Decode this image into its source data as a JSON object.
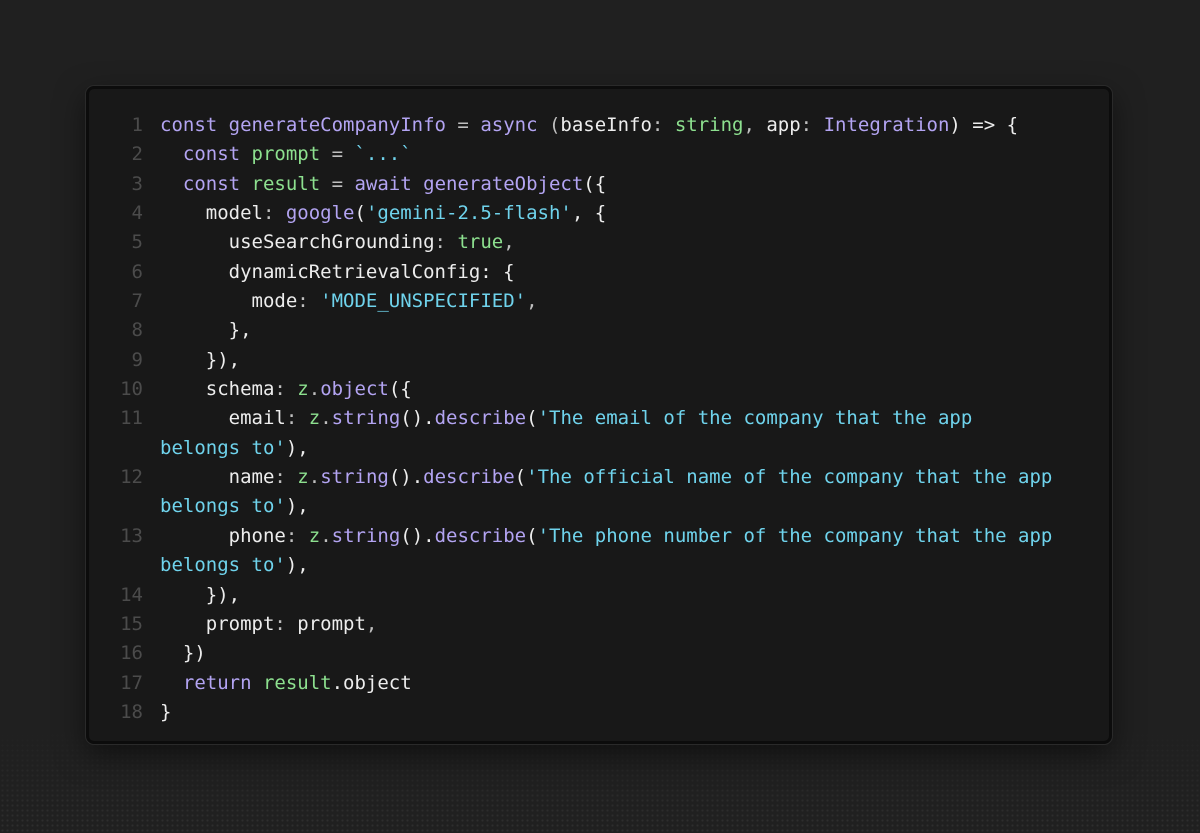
{
  "editor": {
    "lines": [
      {
        "number": "1",
        "tokens": [
          {
            "t": "const ",
            "c": "kw"
          },
          {
            "t": "generateCompanyInfo",
            "c": "fn"
          },
          {
            "t": " = ",
            "c": "p"
          },
          {
            "t": "async",
            "c": "kw"
          },
          {
            "t": " (",
            "c": "p"
          },
          {
            "t": "baseInfo",
            "c": "t"
          },
          {
            "t": ": ",
            "c": "p"
          },
          {
            "t": "string",
            "c": "def"
          },
          {
            "t": ", ",
            "c": "p"
          },
          {
            "t": "app",
            "c": "t"
          },
          {
            "t": ": ",
            "c": "p"
          },
          {
            "t": "Integration",
            "c": "type"
          },
          {
            "t": ") => {",
            "c": "t"
          }
        ]
      },
      {
        "number": "2",
        "tokens": [
          {
            "t": "  const ",
            "c": "kw"
          },
          {
            "t": "prompt",
            "c": "def"
          },
          {
            "t": " = ",
            "c": "p"
          },
          {
            "t": "`...`",
            "c": "str"
          }
        ]
      },
      {
        "number": "3",
        "tokens": [
          {
            "t": "  const ",
            "c": "kw"
          },
          {
            "t": "result",
            "c": "def"
          },
          {
            "t": " = ",
            "c": "p"
          },
          {
            "t": "await ",
            "c": "kw"
          },
          {
            "t": "generateObject",
            "c": "fn"
          },
          {
            "t": "({",
            "c": "t"
          }
        ]
      },
      {
        "number": "4",
        "tokens": [
          {
            "t": "    model",
            "c": "t"
          },
          {
            "t": ": ",
            "c": "p"
          },
          {
            "t": "google",
            "c": "fn"
          },
          {
            "t": "(",
            "c": "t"
          },
          {
            "t": "'gemini-2.5-flash'",
            "c": "str"
          },
          {
            "t": ", {",
            "c": "t"
          }
        ]
      },
      {
        "number": "5",
        "tokens": [
          {
            "t": "      useSearchGrounding",
            "c": "t"
          },
          {
            "t": ": ",
            "c": "p"
          },
          {
            "t": "true",
            "c": "def"
          },
          {
            "t": ",",
            "c": "p"
          }
        ]
      },
      {
        "number": "6",
        "tokens": [
          {
            "t": "      dynamicRetrievalConfig",
            "c": "t"
          },
          {
            "t": ": {",
            "c": "t"
          }
        ]
      },
      {
        "number": "7",
        "tokens": [
          {
            "t": "        mode",
            "c": "t"
          },
          {
            "t": ": ",
            "c": "p"
          },
          {
            "t": "'MODE_UNSPECIFIED'",
            "c": "str"
          },
          {
            "t": ",",
            "c": "p"
          }
        ]
      },
      {
        "number": "8",
        "tokens": [
          {
            "t": "      },",
            "c": "t"
          }
        ]
      },
      {
        "number": "9",
        "tokens": [
          {
            "t": "    }),",
            "c": "t"
          }
        ]
      },
      {
        "number": "10",
        "tokens": [
          {
            "t": "    schema",
            "c": "t"
          },
          {
            "t": ": ",
            "c": "p"
          },
          {
            "t": "z",
            "c": "def"
          },
          {
            "t": ".",
            "c": "p"
          },
          {
            "t": "object",
            "c": "fn"
          },
          {
            "t": "({",
            "c": "t"
          }
        ]
      },
      {
        "number": "11",
        "tokens": [
          {
            "t": "      email",
            "c": "t"
          },
          {
            "t": ": ",
            "c": "p"
          },
          {
            "t": "z",
            "c": "def"
          },
          {
            "t": ".",
            "c": "p"
          },
          {
            "t": "string",
            "c": "fn"
          },
          {
            "t": "().",
            "c": "t"
          },
          {
            "t": "describe",
            "c": "fn"
          },
          {
            "t": "(",
            "c": "t"
          },
          {
            "t": "'The email of the company that the app",
            "c": "str"
          }
        ]
      },
      {
        "number": "",
        "tokens": [
          {
            "t": "belongs to'",
            "c": "str"
          },
          {
            "t": "),",
            "c": "t"
          }
        ]
      },
      {
        "number": "12",
        "tokens": [
          {
            "t": "      name",
            "c": "t"
          },
          {
            "t": ": ",
            "c": "p"
          },
          {
            "t": "z",
            "c": "def"
          },
          {
            "t": ".",
            "c": "p"
          },
          {
            "t": "string",
            "c": "fn"
          },
          {
            "t": "().",
            "c": "t"
          },
          {
            "t": "describe",
            "c": "fn"
          },
          {
            "t": "(",
            "c": "t"
          },
          {
            "t": "'The official name of the company that the app",
            "c": "str"
          }
        ]
      },
      {
        "number": "",
        "tokens": [
          {
            "t": "belongs to'",
            "c": "str"
          },
          {
            "t": "),",
            "c": "t"
          }
        ]
      },
      {
        "number": "13",
        "tokens": [
          {
            "t": "      phone",
            "c": "t"
          },
          {
            "t": ": ",
            "c": "p"
          },
          {
            "t": "z",
            "c": "def"
          },
          {
            "t": ".",
            "c": "p"
          },
          {
            "t": "string",
            "c": "fn"
          },
          {
            "t": "().",
            "c": "t"
          },
          {
            "t": "describe",
            "c": "fn"
          },
          {
            "t": "(",
            "c": "t"
          },
          {
            "t": "'The phone number of the company that the app",
            "c": "str"
          }
        ]
      },
      {
        "number": "",
        "tokens": [
          {
            "t": "belongs to'",
            "c": "str"
          },
          {
            "t": "),",
            "c": "t"
          }
        ]
      },
      {
        "number": "14",
        "tokens": [
          {
            "t": "    }),",
            "c": "t"
          }
        ]
      },
      {
        "number": "15",
        "tokens": [
          {
            "t": "    prompt",
            "c": "t"
          },
          {
            "t": ": ",
            "c": "p"
          },
          {
            "t": "prompt",
            "c": "t"
          },
          {
            "t": ",",
            "c": "p"
          }
        ]
      },
      {
        "number": "16",
        "tokens": [
          {
            "t": "  })",
            "c": "t"
          }
        ]
      },
      {
        "number": "17",
        "tokens": [
          {
            "t": "  return ",
            "c": "kw"
          },
          {
            "t": "result",
            "c": "def"
          },
          {
            "t": ".object",
            "c": "t"
          }
        ]
      },
      {
        "number": "18",
        "tokens": [
          {
            "t": "}",
            "c": "t"
          }
        ]
      }
    ]
  }
}
